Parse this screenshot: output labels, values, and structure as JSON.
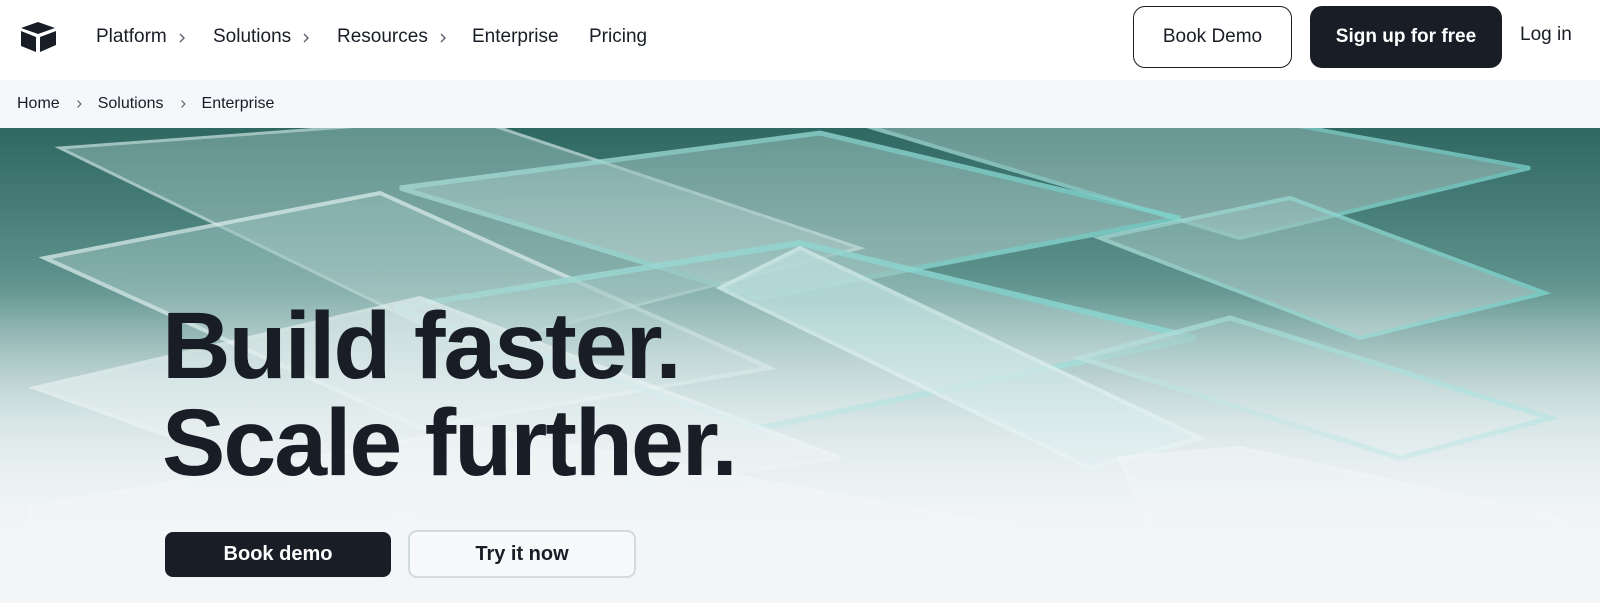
{
  "nav": {
    "logo": "airtable-logo-icon",
    "items": [
      {
        "label": "Platform",
        "has_chevron": true
      },
      {
        "label": "Solutions",
        "has_chevron": true
      },
      {
        "label": "Resources",
        "has_chevron": true
      },
      {
        "label": "Enterprise",
        "has_chevron": false
      },
      {
        "label": "Pricing",
        "has_chevron": false
      }
    ],
    "book_demo": "Book Demo",
    "sign_up": "Sign up for free",
    "log_in": "Log in"
  },
  "breadcrumb": [
    "Home",
    "Solutions",
    "Enterprise"
  ],
  "hero": {
    "headline_line1": "Build faster.",
    "headline_line2": "Scale further.",
    "primary_cta": "Book demo",
    "secondary_cta": "Try it now"
  },
  "colors": {
    "ink": "#181d26",
    "breadcrumb_bg": "#f5f7fa",
    "hero_teal": "#2f6762",
    "hero_light": "#f3f6f8"
  }
}
